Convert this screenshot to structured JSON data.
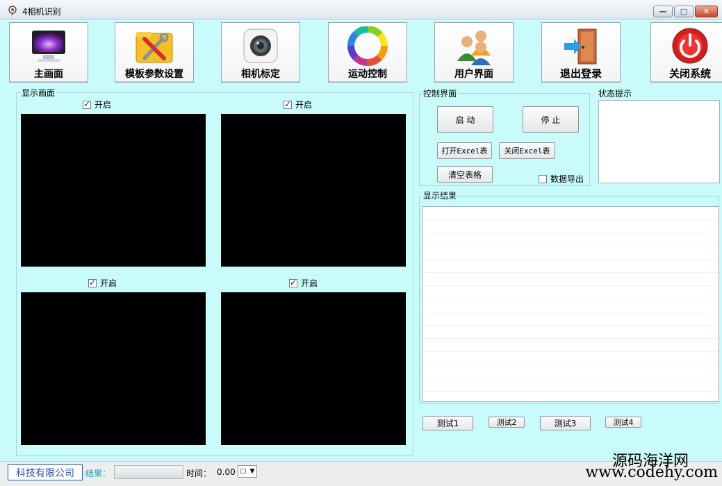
{
  "window": {
    "title": "4相机识别"
  },
  "toolbar": {
    "items": [
      {
        "label": "主画面",
        "icon": "monitor-icon"
      },
      {
        "label": "模板参数设置",
        "icon": "tools-folder-icon"
      },
      {
        "label": "相机标定",
        "icon": "camera-icon"
      },
      {
        "label": "运动控制",
        "icon": "color-wheel-icon"
      },
      {
        "label": "用户界面",
        "icon": "users-icon"
      },
      {
        "label": "退出登录",
        "icon": "exit-door-icon"
      },
      {
        "label": "关闭系统",
        "icon": "power-icon"
      }
    ]
  },
  "display": {
    "title": "显示画面",
    "cameras": [
      {
        "enable_label": "开启",
        "checked": true
      },
      {
        "enable_label": "开启",
        "checked": true
      },
      {
        "enable_label": "开启",
        "checked": true
      },
      {
        "enable_label": "开启",
        "checked": true
      }
    ]
  },
  "control": {
    "title": "控制界面",
    "start_label": "启 动",
    "stop_label": "停 止",
    "open_excel_label": "打开Excel表",
    "close_excel_label": "关闭Excel表",
    "clear_table_label": "清空表格",
    "export_label": "数据导出"
  },
  "status": {
    "title": "状态提示"
  },
  "results": {
    "title": "显示结果",
    "tests": [
      "测试1",
      "测试2",
      "测试3",
      "测试4"
    ]
  },
  "statusbar": {
    "company": "科技有限公司",
    "result_label": "结果：",
    "time_label": "时间：",
    "time_value": "0.00"
  },
  "watermark": {
    "line1": "源码海洋网",
    "line2": "www.codehy.com"
  },
  "colors": {
    "background": "#c9fbfb",
    "company_text": "#2d57a7",
    "result_label": "#2aa1b3"
  }
}
